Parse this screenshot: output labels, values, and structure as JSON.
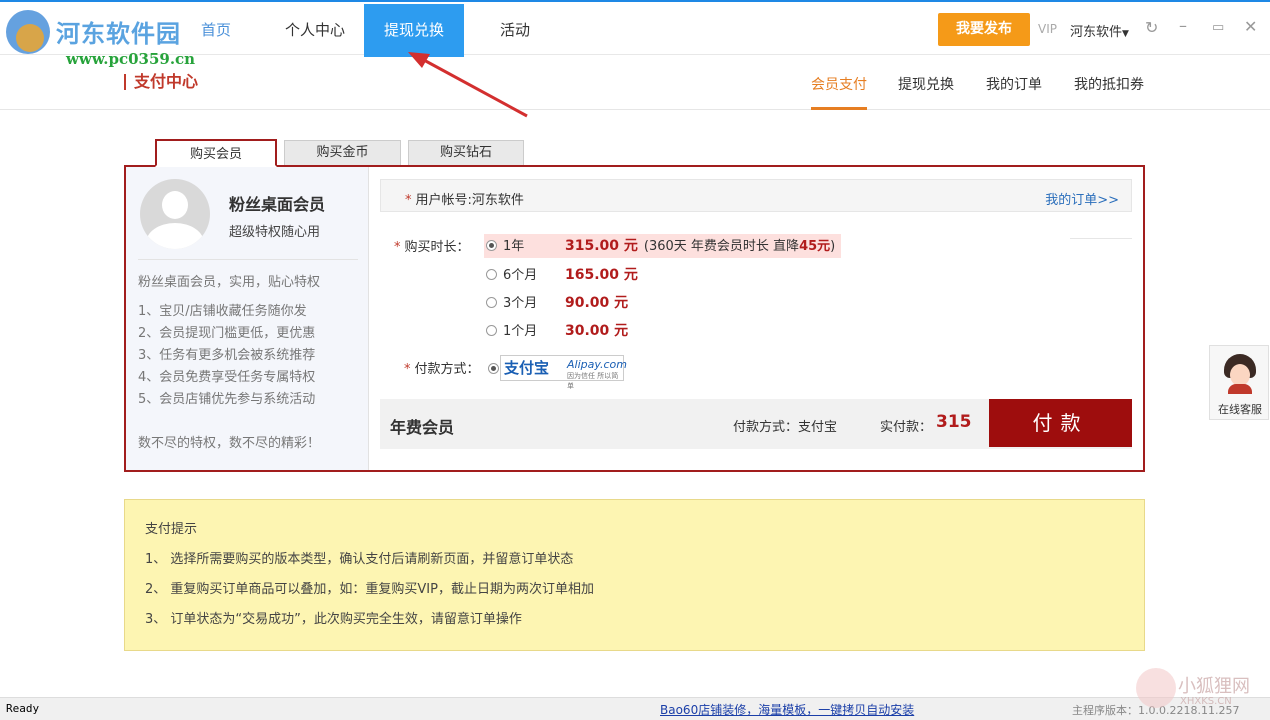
{
  "app": {
    "logo_text": "河东软件园",
    "logo_url": "www.pc0359.cn",
    "nav": {
      "home": "首页",
      "user_center": "个人中心",
      "withdraw": "提现兑换",
      "activity": "活动"
    },
    "publish_button": "我要发布",
    "vip_label": "VIP",
    "username": "河东软件",
    "colors": {
      "accent_blue": "#2d9cf0",
      "accent_red": "#a11d1d",
      "accent_orange": "#f59a18"
    }
  },
  "subheader": {
    "title": "支付中心",
    "links": [
      "会员支付",
      "提现兑换",
      "我的订单",
      "我的抵扣券"
    ],
    "active_link": "会员支付"
  },
  "tabs": [
    "购买会员",
    "购买金币",
    "购买钻石"
  ],
  "active_tab": "购买会员",
  "member": {
    "title": "粉丝桌面会员",
    "subtitle": "超级特权随心用",
    "intro": "粉丝桌面会员，实用，贴心特权",
    "benefits": [
      "1、宝贝/店铺收藏任务随你发",
      "2、会员提现门槛更低，更优惠",
      "3、任务有更多机会被系统推荐",
      "4、会员免费享受任务专属特权",
      "5、会员店铺优先参与系统活动"
    ],
    "footer": "数不尽的特权，数不尽的精彩！"
  },
  "order": {
    "account_label": "用户帐号:河东软件",
    "my_orders_link": "我的订单>>",
    "duration_label": "购买时长：",
    "options": [
      {
        "duration": "1年",
        "price": "315.00 元",
        "note_prefix": "(360天 年费会员时长 直降",
        "note_amount": "45元",
        "note_suffix": ")"
      },
      {
        "duration": "6个月",
        "price": "165.00 元"
      },
      {
        "duration": "3个月",
        "price": "90.00 元"
      },
      {
        "duration": "1个月",
        "price": "30.00 元"
      }
    ],
    "selected_option": "1年",
    "payment_label": "付款方式：",
    "payment_method": {
      "name_cn": "支付宝",
      "name_en": "Alipay.com",
      "tagline": "因为信任 所以简单"
    },
    "summary_title": "年费会员",
    "summary_method": "付款方式：支付宝",
    "summary_amount_label": "实付款：",
    "summary_amount": "315",
    "pay_button": "付款"
  },
  "tips": {
    "title": "支付提示",
    "lines": [
      "1、 选择所需要购买的版本类型，确认支付后请刷新页面，并留意订单状态",
      "2、 重复购买订单商品可以叠加，如：重复购买VIP，截止日期为两次订单相加",
      "3、 订单状态为“交易成功”，此次购买完全生效，请留意订单操作"
    ]
  },
  "service": {
    "label": "在线客服"
  },
  "statusbar": {
    "ready": "Ready",
    "ad_link": "Bao60店铺装修，海量模板，一键拷贝自动安装",
    "version": "主程序版本：1.0.0.2218.11.257"
  },
  "watermark": {
    "text": "小狐狸网",
    "sub": "XHXKS.CN"
  }
}
